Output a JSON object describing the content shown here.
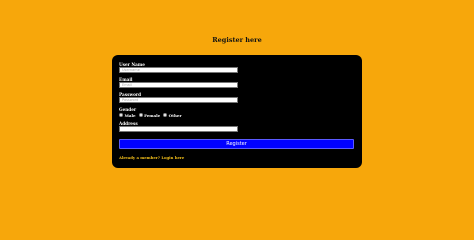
{
  "page": {
    "title": "Register here"
  },
  "form": {
    "user_name": {
      "label": "User Name",
      "placeholder": "Username"
    },
    "email": {
      "label": "Email",
      "placeholder": "Email"
    },
    "password": {
      "label": "Password",
      "placeholder": "Password"
    },
    "gender": {
      "label": "Gender",
      "options": [
        "Male",
        "Female",
        "Other"
      ]
    },
    "address": {
      "label": "Address",
      "placeholder": ""
    },
    "register_label": "Register",
    "login_prompt": "Already a member?",
    "login_link": "Login here"
  },
  "colors": {
    "background": "#f7a70b",
    "card": "#000000",
    "button": "#0000ff",
    "link": "#f7c21a"
  }
}
